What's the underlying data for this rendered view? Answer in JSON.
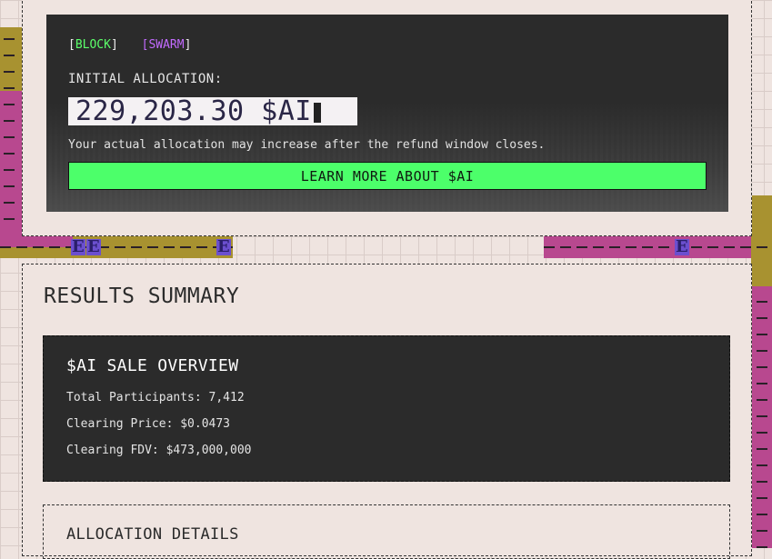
{
  "allocation": {
    "tags": {
      "block": "BLOCK",
      "swarm": "SWARM"
    },
    "label": "INITIAL ALLOCATION:",
    "amount": "229,203.30 $AI",
    "note": "Your actual allocation may increase after the refund window closes.",
    "learn_button": "LEARN MORE ABOUT $AI"
  },
  "results": {
    "title": "RESULTS SUMMARY",
    "overview": {
      "title": "$AI SALE OVERVIEW",
      "participants": "Total Participants: 7,412",
      "price": "Clearing Price: $0.0473",
      "fdv": "Clearing FDV: $473,000,000"
    },
    "details_title": "ALLOCATION DETAILS"
  },
  "decor": {
    "glyph": "E"
  },
  "colors": {
    "accent_green": "#4cff6a",
    "tag_green": "#5bff6a",
    "tag_purple": "#c36bff",
    "panel_dark": "#2b2b2b",
    "stripe_gold": "#a89230",
    "stripe_pink": "#b8488f"
  }
}
